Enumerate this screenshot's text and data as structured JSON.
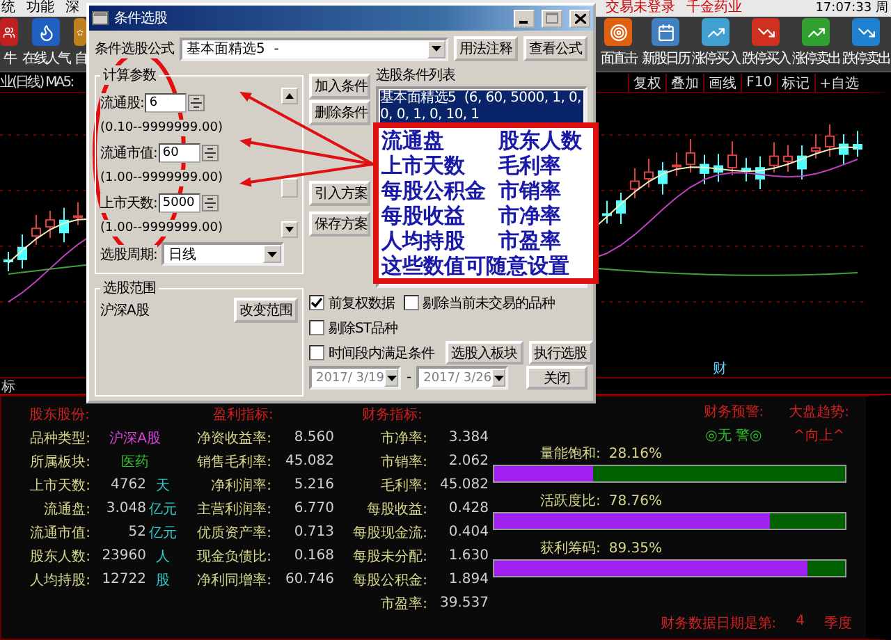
{
  "menu_bar": {
    "items": [
      "统",
      "功能",
      "深"
    ],
    "notices": [
      "交易未登录",
      "千金药业"
    ],
    "clock": "17:07:33 周"
  },
  "toolbar": {
    "left": [
      "牛",
      "在线人气",
      "自"
    ],
    "right": [
      "面直击",
      "新股日历",
      "涨停买入",
      "跌停买入",
      "涨停卖出",
      "跌停卖出"
    ]
  },
  "chart": {
    "title": "业(日线) MA5:",
    "buttons": [
      "复权",
      "叠加",
      "画线",
      "F10",
      "标记",
      "+自选"
    ],
    "marker": "财"
  },
  "indicator_tab": "标",
  "dialog": {
    "title": "条件选股",
    "formula_label": "条件选股公式",
    "formula": "基本面精选5  -",
    "top_buttons": [
      "用法注释",
      "查看公式"
    ],
    "params_group": "计算参数",
    "params": [
      {
        "label": "流通股:",
        "value": "6",
        "range": "(0.10--9999999.00)"
      },
      {
        "label": "流通市值:",
        "value": "60",
        "range": "(1.00--9999999.00)"
      },
      {
        "label": "上市天数:",
        "value": "5000",
        "range": "(1.00--9999999.00)"
      }
    ],
    "period_label": "选股周期:",
    "period": "日线",
    "scope_group": "选股范围",
    "scope": "沪深A股",
    "scope_button": "改变范围",
    "action_buttons": [
      "加入条件",
      "删除条件",
      "引入方案",
      "保存方案"
    ],
    "list_label": "选股条件列表",
    "conditions": [
      {
        "text": "基本面精选5  (6, 60, 5000, 1, 0, 0, 0, 1, 0, 10, 1",
        "selected": true
      }
    ],
    "options": [
      {
        "label": "前复权数据",
        "checked": true
      },
      {
        "label": "剔除当前未交易的品种",
        "checked": false
      },
      {
        "label": "剔除ST品种",
        "checked": false
      }
    ],
    "range_option": {
      "label": "时间段内满足条件",
      "checked": false
    },
    "dates": [
      {
        "value": "2017/ 3/19",
        "disabled": true
      },
      {
        "value": "2017/ 3/26",
        "disabled": true
      }
    ],
    "date_separator": "-",
    "bottom_buttons": [
      "选股入板块",
      "执行选股",
      "关闭"
    ]
  },
  "annotation": {
    "lines": [
      [
        "流通盘",
        "股东人数"
      ],
      [
        "上市天数",
        "毛利率"
      ],
      [
        "每股公积金",
        "市销率"
      ],
      [
        "每股收益",
        "市净率"
      ],
      [
        "人均持股",
        "市盈率"
      ]
    ],
    "caption": "这些数值可随意设置"
  },
  "panel": {
    "headers": [
      "股东股份:",
      "盈利指标:",
      "财务指标:"
    ],
    "basic": [
      {
        "label": "品种类型:",
        "value": "沪深A股",
        "color": "#e040e0"
      },
      {
        "label": "所属板块:",
        "value": "医药",
        "color": "#30c030"
      },
      {
        "label": "上市天数:",
        "value": "4762",
        "unit": "天"
      },
      {
        "label": "流通盘:",
        "value": "3.048",
        "unit": "亿元"
      },
      {
        "label": "流通市值:",
        "value": "52",
        "unit": "亿元"
      },
      {
        "label": "股东人数:",
        "value": "23960",
        "unit": "人"
      },
      {
        "label": "人均持股:",
        "value": "12722",
        "unit": "股"
      }
    ],
    "profit": [
      {
        "label": "净资收益率:",
        "value": "8.560"
      },
      {
        "label": "销售毛利率:",
        "value": "45.082"
      },
      {
        "label": "净利润率:",
        "value": "5.216"
      },
      {
        "label": "主营利润率:",
        "value": "6.770"
      },
      {
        "label": "优质资产率:",
        "value": "0.713"
      },
      {
        "label": "现金负债比:",
        "value": "0.168"
      },
      {
        "label": "净利同增率:",
        "value": "60.746"
      }
    ],
    "finance": [
      {
        "label": "市净率:",
        "value": "3.384"
      },
      {
        "label": "市销率:",
        "value": "2.062"
      },
      {
        "label": "毛利率:",
        "value": "45.082"
      },
      {
        "label": "每股收益:",
        "value": "0.428"
      },
      {
        "label": "每股现金流:",
        "value": "0.404"
      },
      {
        "label": "每股未分配:",
        "value": "1.630"
      },
      {
        "label": "每股公积金:",
        "value": "1.894"
      },
      {
        "label": "市盈率:",
        "value": "39.537"
      }
    ],
    "alert": {
      "label": "财务预警:",
      "value": "◎无 警◎"
    },
    "trend": {
      "label": "大盘趋势:",
      "value": "^向上^"
    },
    "meters": [
      {
        "label": "量能饱和:",
        "reading": "28.16%",
        "level": 0.2816
      },
      {
        "label": "活跃度比:",
        "reading": "78.76%",
        "level": 0.7876
      },
      {
        "label": "获利筹码:",
        "reading": "89.35%",
        "level": 0.8935
      }
    ],
    "report": {
      "label": "财务数据日期是第:",
      "value": "4",
      "unit": "季度"
    }
  }
}
